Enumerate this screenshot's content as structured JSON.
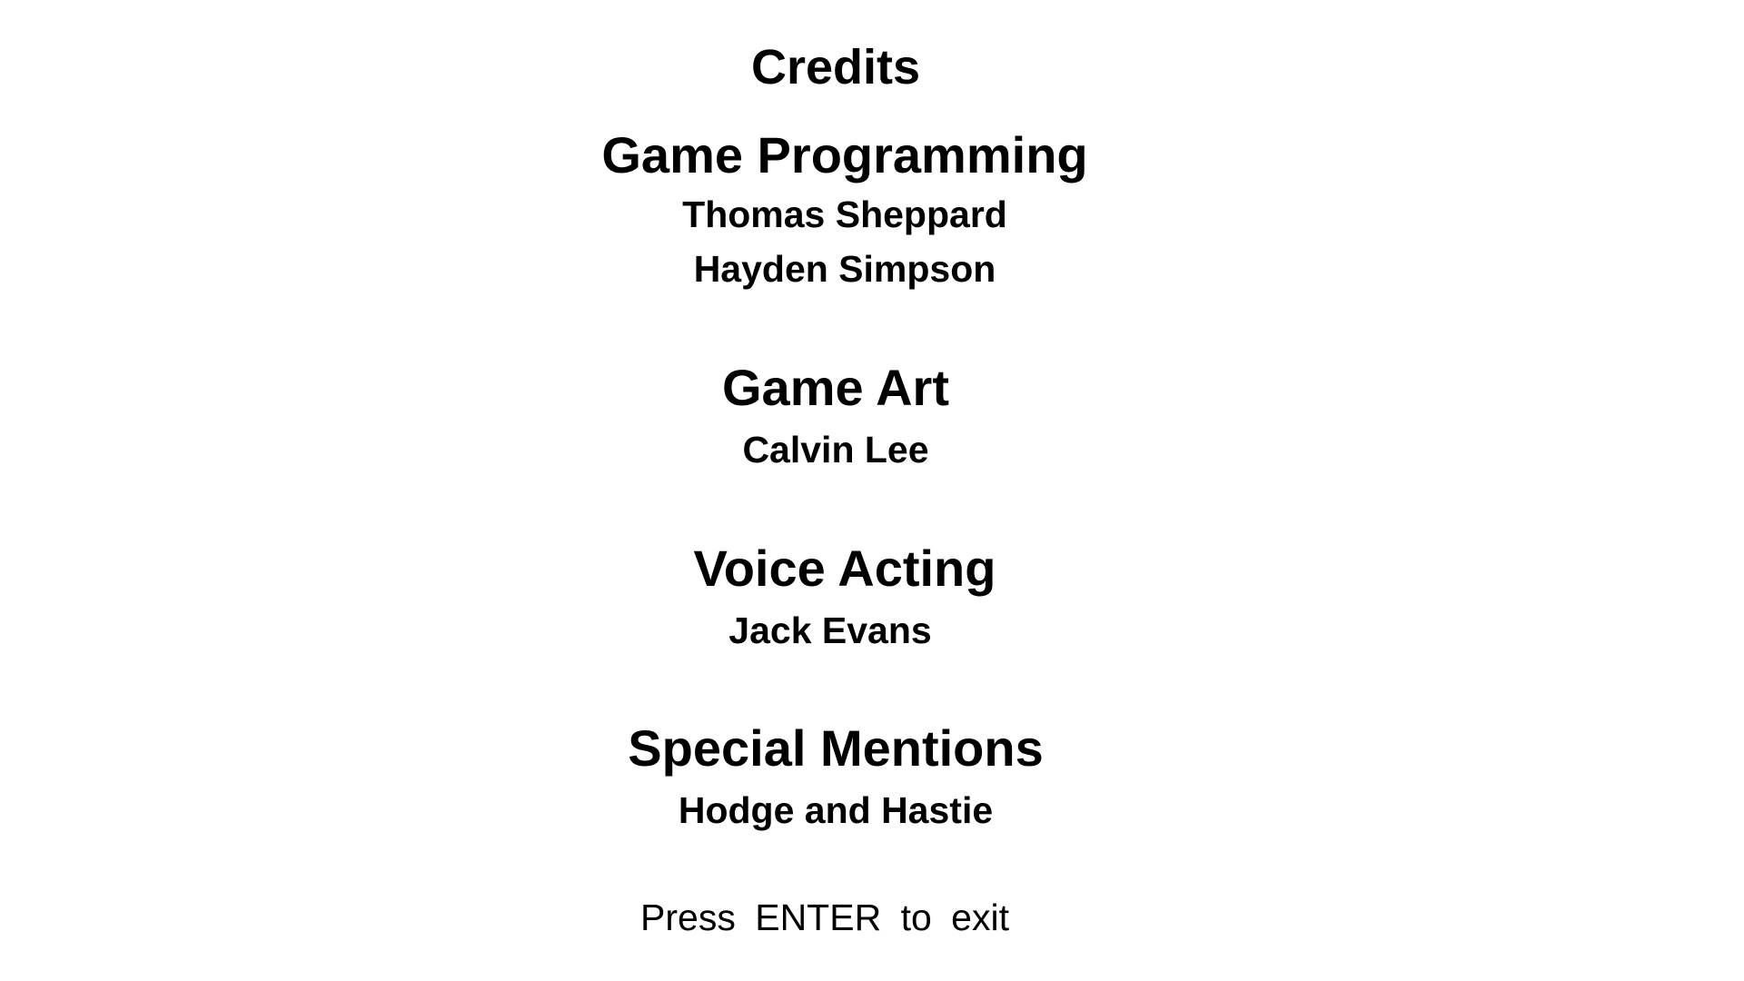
{
  "title": "Credits",
  "sections": [
    {
      "heading": "Game Programming",
      "names": [
        "Thomas Sheppard",
        "Hayden Simpson"
      ]
    },
    {
      "heading": "Game Art",
      "names": [
        "Calvin Lee"
      ]
    },
    {
      "heading": "Voice Acting",
      "names": [
        "Jack Evans"
      ]
    },
    {
      "heading": "Special Mentions",
      "names": [
        "Hodge and Hastie"
      ]
    }
  ],
  "exit_prompt": "Press  ENTER  to exit",
  "colors": {
    "background": "#ffffff",
    "text": "#000000"
  }
}
